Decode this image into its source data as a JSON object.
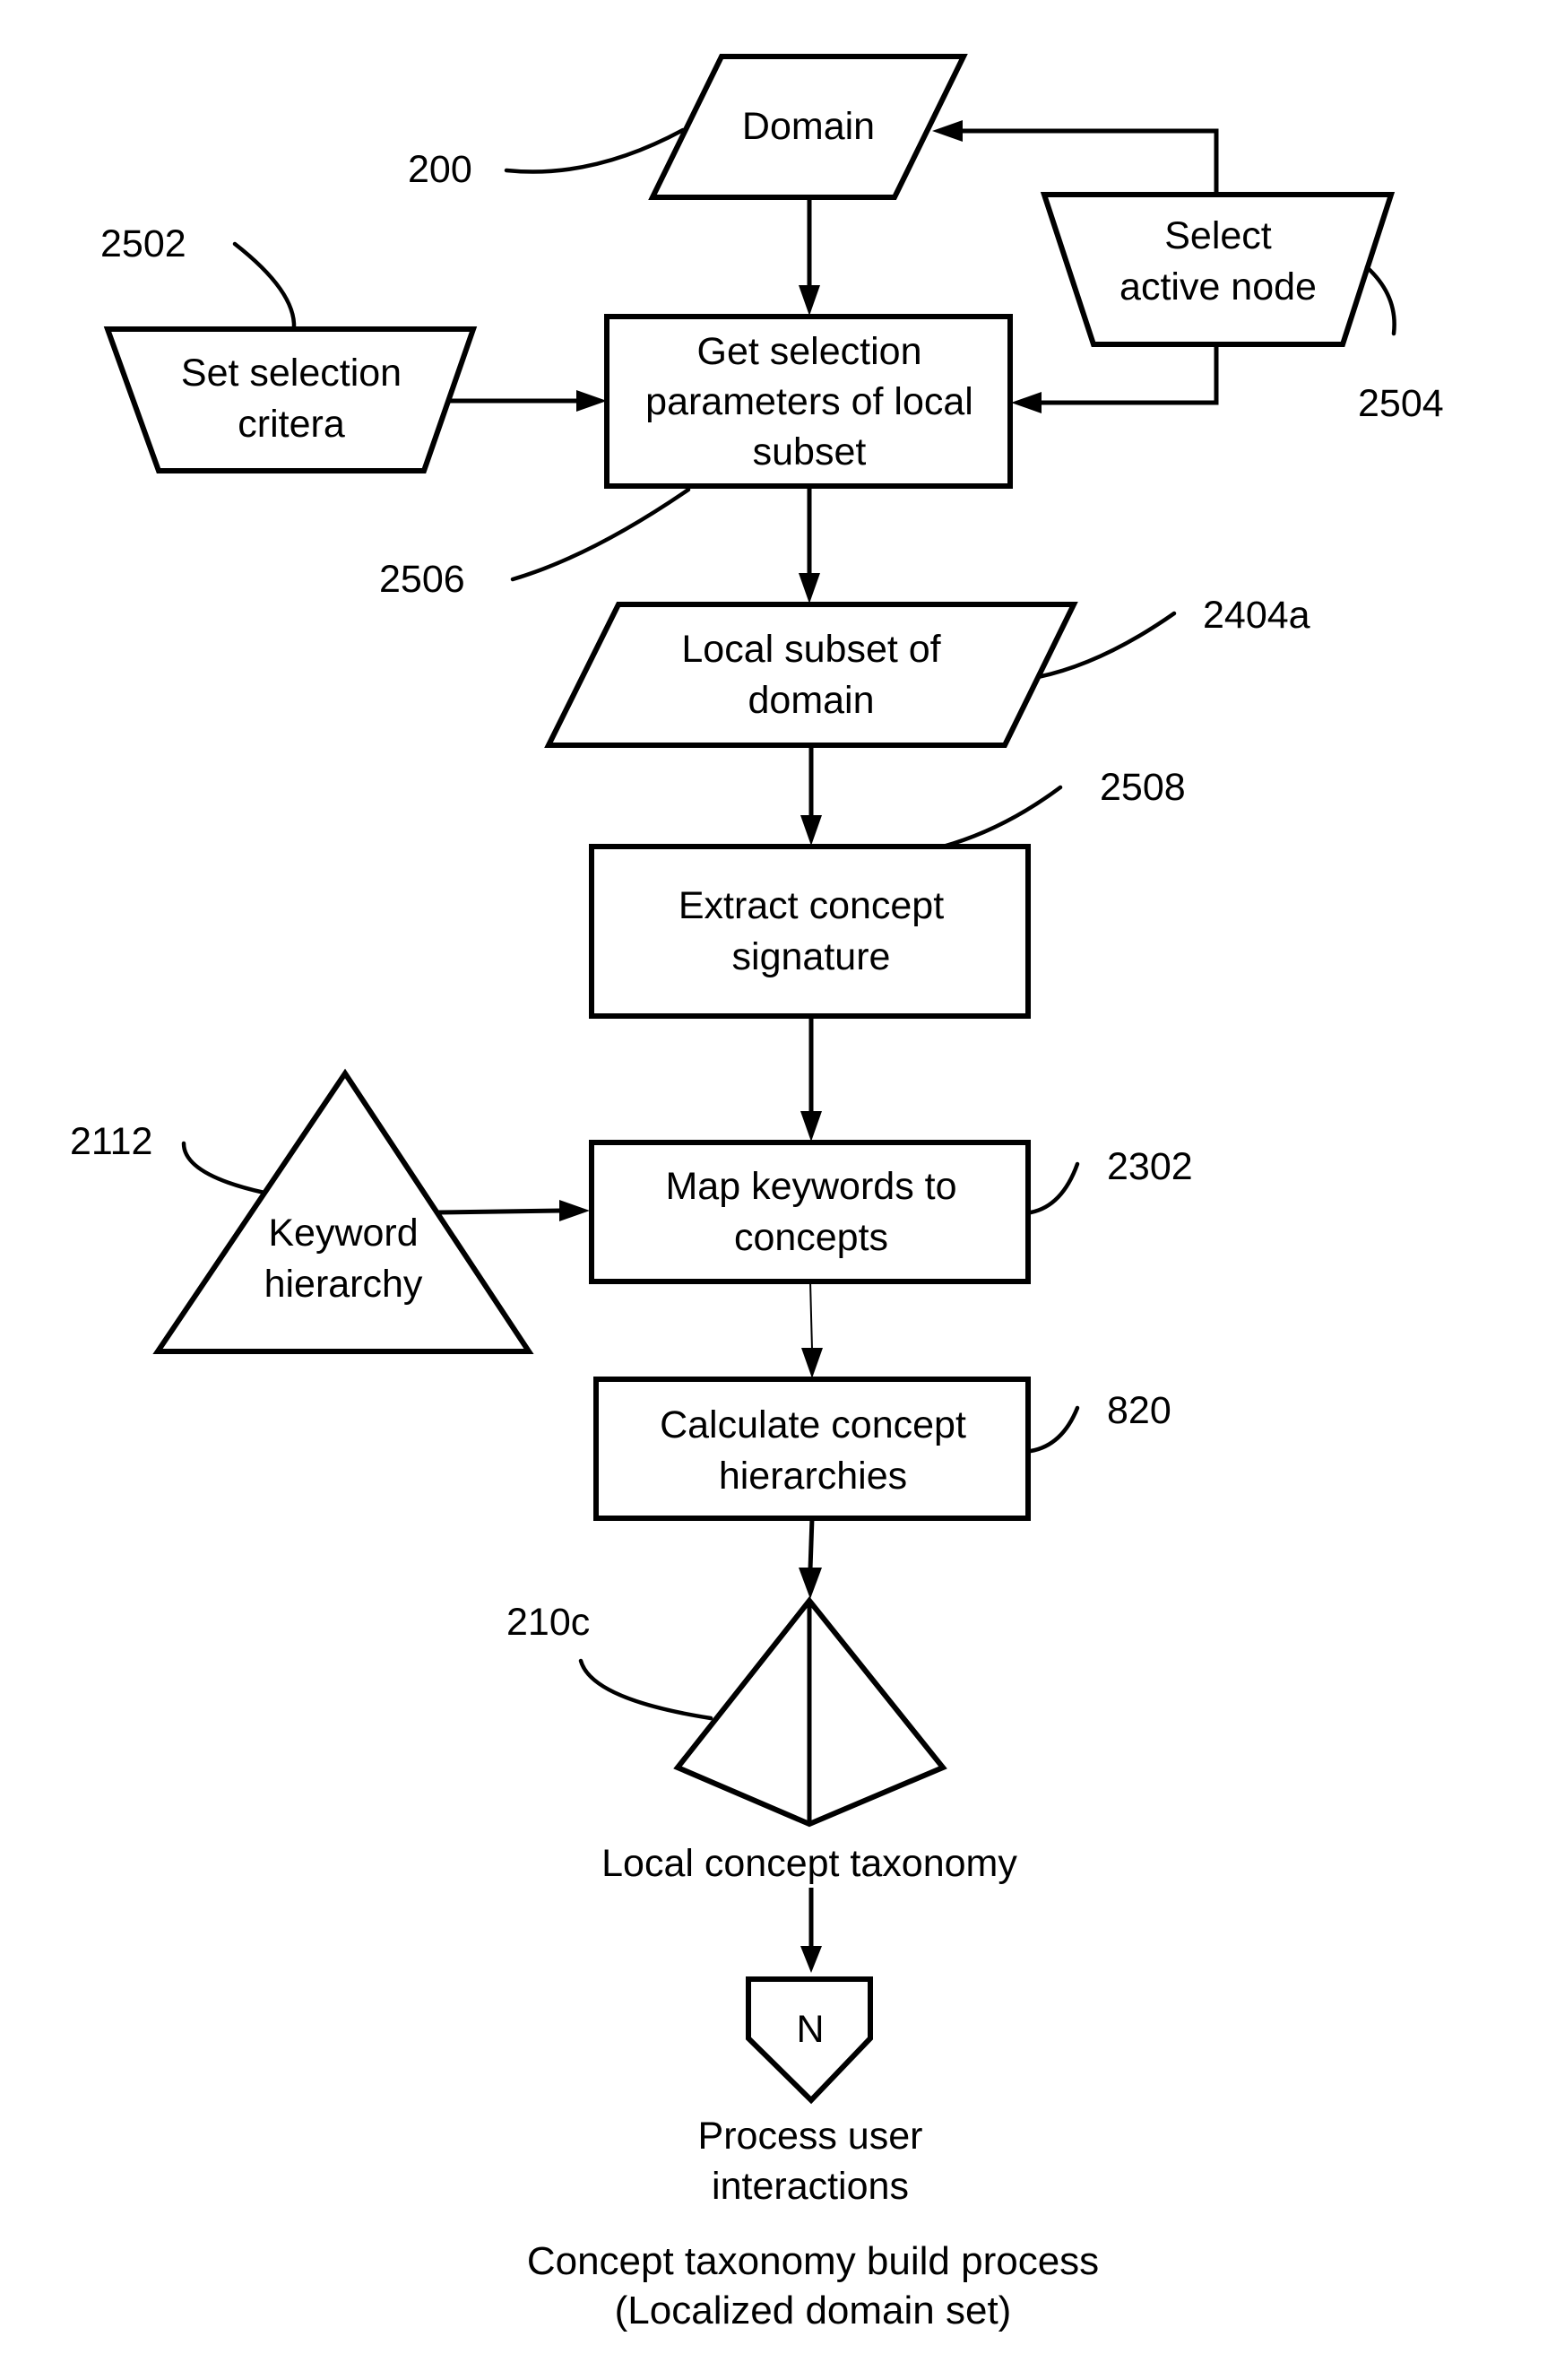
{
  "figure": {
    "nodes": {
      "domain": {
        "lines": [
          "Domain"
        ],
        "ref": "200",
        "shape": "parallelogram"
      },
      "set_criteria": {
        "lines": [
          "Set selection",
          "critera"
        ],
        "ref": "2502",
        "shape": "manual-operation"
      },
      "select_node": {
        "lines": [
          "Select",
          "active node"
        ],
        "ref": "2504",
        "shape": "manual-operation"
      },
      "get_params": {
        "lines": [
          "Get selection",
          "parameters of local",
          "subset"
        ],
        "ref": "2506",
        "shape": "process"
      },
      "local_subset": {
        "lines": [
          "Local subset of",
          "domain"
        ],
        "ref": "2404a",
        "shape": "parallelogram"
      },
      "extract": {
        "lines": [
          "Extract concept",
          "signature"
        ],
        "ref": "2508",
        "shape": "process"
      },
      "keyword_hierarchy": {
        "lines": [
          "Keyword",
          "hierarchy"
        ],
        "ref": "2112",
        "shape": "triangle"
      },
      "map_keywords": {
        "lines": [
          "Map keywords to",
          "concepts"
        ],
        "ref": "2302",
        "shape": "process"
      },
      "calc_hier": {
        "lines": [
          "Calculate concept",
          "hierarchies"
        ],
        "ref": "820",
        "shape": "process"
      },
      "taxonomy": {
        "lines": [
          "Local concept taxonomy"
        ],
        "ref": "210c",
        "shape": "pyramid"
      },
      "connector": {
        "symbol": "N",
        "lines": [
          "Process user",
          "interactions"
        ],
        "shape": "off-page-connector"
      }
    },
    "edges": [
      {
        "from": "domain",
        "to": "get_params"
      },
      {
        "from": "set_criteria",
        "to": "get_params"
      },
      {
        "from": "select_node",
        "to": "domain"
      },
      {
        "from": "select_node",
        "to": "get_params"
      },
      {
        "from": "get_params",
        "to": "local_subset"
      },
      {
        "from": "local_subset",
        "to": "extract"
      },
      {
        "from": "extract",
        "to": "map_keywords"
      },
      {
        "from": "keyword_hierarchy",
        "to": "map_keywords"
      },
      {
        "from": "map_keywords",
        "to": "calc_hier"
      },
      {
        "from": "calc_hier",
        "to": "taxonomy"
      },
      {
        "from": "taxonomy",
        "to": "connector"
      }
    ],
    "caption": [
      "Concept taxonomy build process",
      "(Localized domain set)"
    ]
  }
}
